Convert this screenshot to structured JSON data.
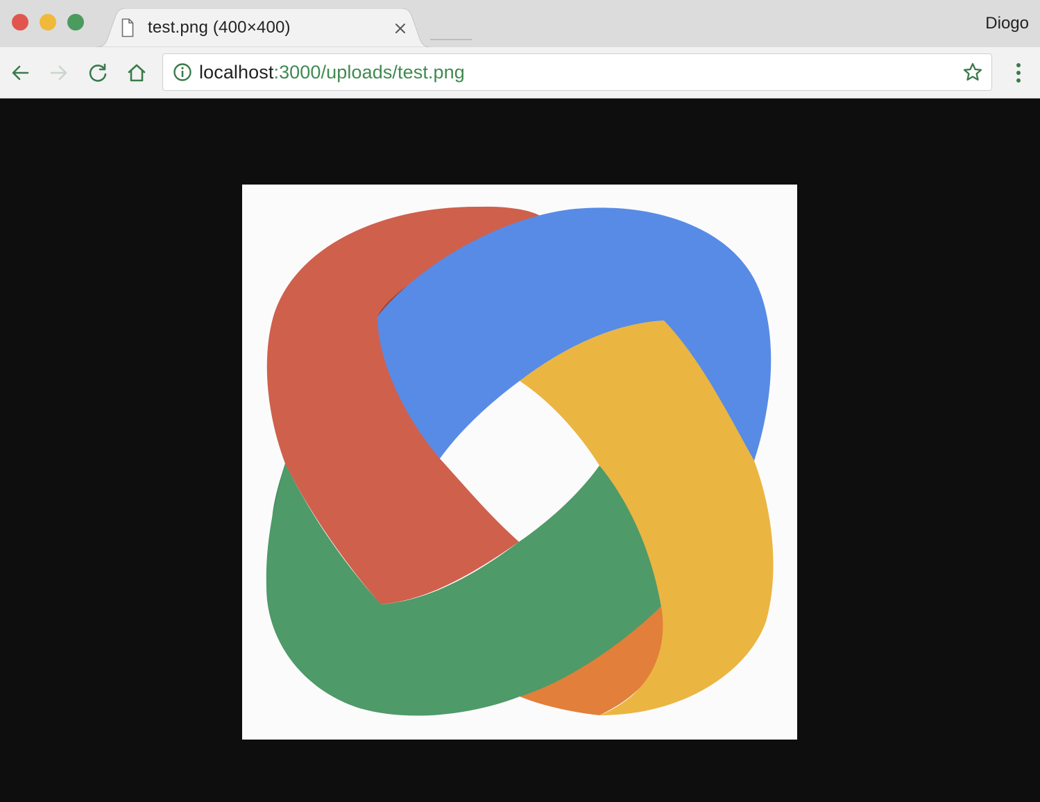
{
  "window": {
    "traffic_lights": {
      "close_color": "#e0564f",
      "minimize_color": "#f0b93a",
      "zoom_color": "#4b9a5e"
    }
  },
  "tab": {
    "title": "test.png (400×400)",
    "icon": "document-icon",
    "close_icon": "close-x-icon"
  },
  "profile": {
    "name": "Diogo"
  },
  "toolbar": {
    "back_icon": "arrow-left-icon",
    "forward_icon": "arrow-right-icon",
    "reload_icon": "reload-icon",
    "home_icon": "home-icon",
    "menu_icon": "vertical-dots-icon"
  },
  "omnibox": {
    "info_icon": "info-circle-icon",
    "url_host": "localhost",
    "url_rest": ":3000/uploads/test.png",
    "bookmark_icon": "star-outline-icon"
  },
  "content": {
    "background": "#0e0e0e",
    "image": {
      "description_colors": {
        "red": "#cf604c",
        "blue": "#588be5",
        "yellow": "#ebb542",
        "green": "#4e9a68"
      }
    }
  },
  "colors": {
    "accent_green": "#3f8a4f",
    "tab_strip": "#dcdcdc",
    "toolbar": "#f2f2f2"
  }
}
